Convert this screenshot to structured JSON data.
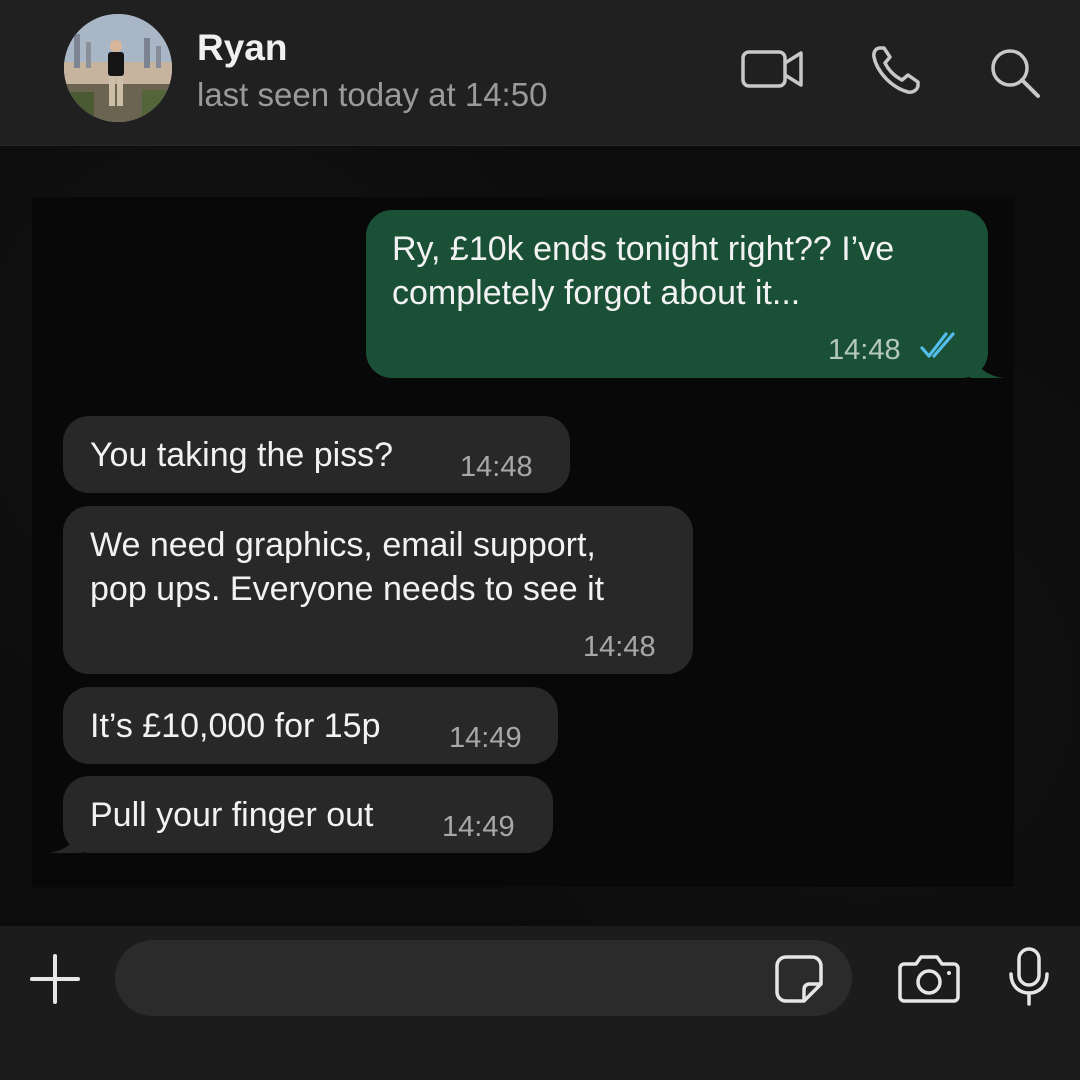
{
  "contact": {
    "name": "Ryan",
    "status": "last seen today at 14:50"
  },
  "header_icons": [
    "video-camera-icon",
    "phone-icon",
    "search-icon"
  ],
  "messages": [
    {
      "direction": "outgoing",
      "lines": [
        "Ry, £10k ends tonight right?? I’ve",
        "completely forgot about it..."
      ],
      "time": "14:48",
      "read": true
    },
    {
      "direction": "incoming",
      "lines": [
        "You taking the piss?"
      ],
      "time": "14:48"
    },
    {
      "direction": "incoming",
      "lines": [
        "We need graphics, email support,",
        "pop ups. Everyone needs to see it"
      ],
      "time": "14:48"
    },
    {
      "direction": "incoming",
      "lines": [
        "It’s £10,000 for 15p"
      ],
      "time": "14:49"
    },
    {
      "direction": "incoming",
      "lines": [
        "Pull your finger out"
      ],
      "time": "14:49"
    }
  ],
  "composer": {
    "value": "",
    "placeholder": ""
  },
  "footer_icons": [
    "plus-icon",
    "sticker-icon",
    "camera-icon",
    "microphone-icon"
  ],
  "colors": {
    "outgoing_bubble": "#1a5136",
    "incoming_bubble": "#282828",
    "read_ticks": "#53bdeb",
    "header_bg": "#202020"
  }
}
